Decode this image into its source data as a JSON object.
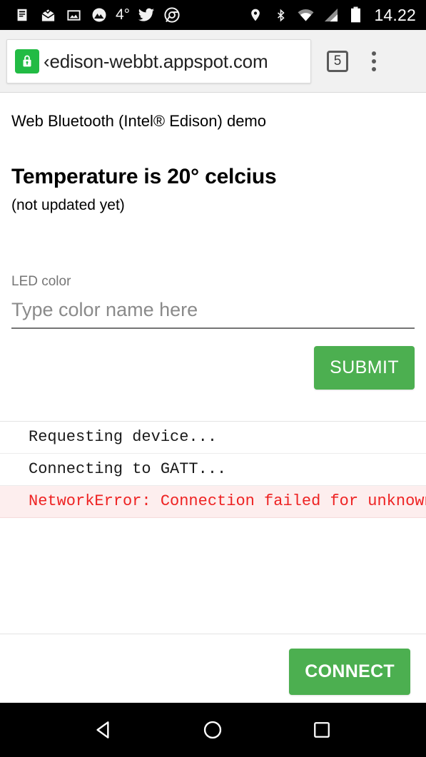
{
  "status_bar": {
    "notification_icons": [
      {
        "name": "news-icon",
        "glyph": "☰"
      },
      {
        "name": "mail-open-icon",
        "glyph": "✉"
      },
      {
        "name": "photo-icon",
        "glyph": "ὛB"
      },
      {
        "name": "weather-icon",
        "glyph": "◑"
      }
    ],
    "temperature": "4°",
    "twitter_icon": "twitter-bird-icon",
    "chrome_icon": "chrome-icon",
    "location_icon": "location-pin-icon",
    "bluetooth_icon": "bluetooth-icon",
    "wifi_icon": "wifi-icon",
    "signal_icon": "cell-signal-icon",
    "battery_icon": "battery-icon",
    "clock": "14.22"
  },
  "browser": {
    "lock_icon": "secure-lock-icon",
    "url": "‹edison-webbt.appspot.com",
    "tab_count": "5",
    "menu_icon": "overflow-menu-icon",
    "accent_secure": "#22bb44"
  },
  "page": {
    "demo_title": "Web Bluetooth (Intel® Edison) demo",
    "temperature_heading": "Temperature is 20° celcius",
    "temperature_status": "(not updated yet)",
    "led_field": {
      "label": "LED color",
      "value": "",
      "placeholder": "Type color name here"
    },
    "submit_label": "SUBMIT",
    "connect_label": "CONNECT",
    "button_color": "#4caf50",
    "log": [
      {
        "text": "Requesting device...",
        "level": "info"
      },
      {
        "text": "Connecting to GATT...",
        "level": "info"
      },
      {
        "text": "NetworkError: Connection failed for unknown",
        "level": "error"
      }
    ],
    "error_color": "#ee2222"
  },
  "nav_bar": {
    "back": "back-triangle-icon",
    "home": "home-circle-icon",
    "recents": "recents-square-icon"
  }
}
